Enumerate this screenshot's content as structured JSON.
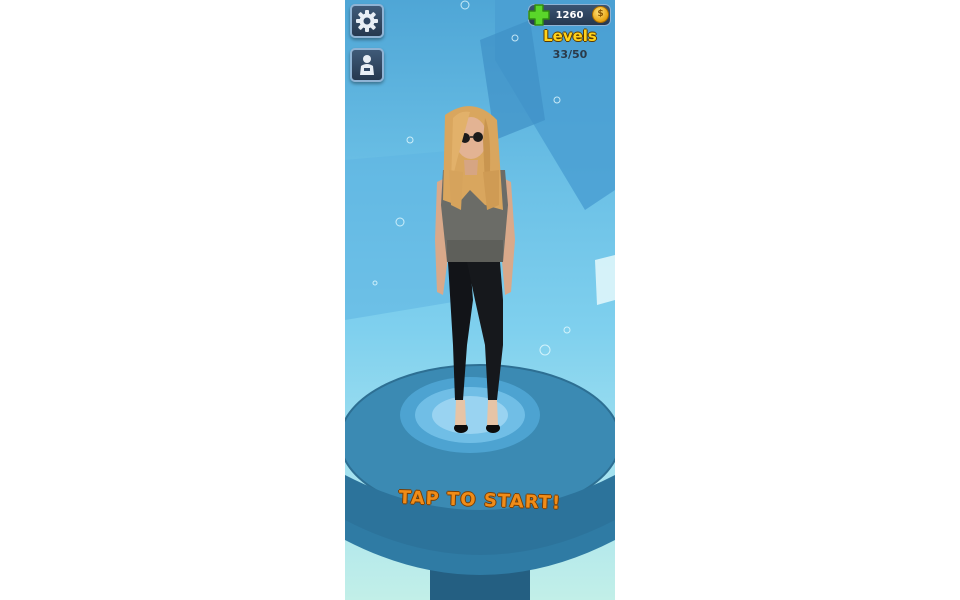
{
  "hud": {
    "coins": "1260",
    "levels_label": "Levels",
    "level_progress": "33/50",
    "icons": {
      "settings": "gear-icon",
      "character": "character-icon",
      "add": "plus-icon",
      "coin": "coin-icon"
    }
  },
  "prompt": {
    "start_label": "TAP TO START!"
  },
  "colors": {
    "sky": "#6bc0e6",
    "platform": "#3b86ad",
    "accent_gold": "#ffd21a",
    "prompt_orange": "#f08c18",
    "plus_green": "#5ad62a"
  }
}
